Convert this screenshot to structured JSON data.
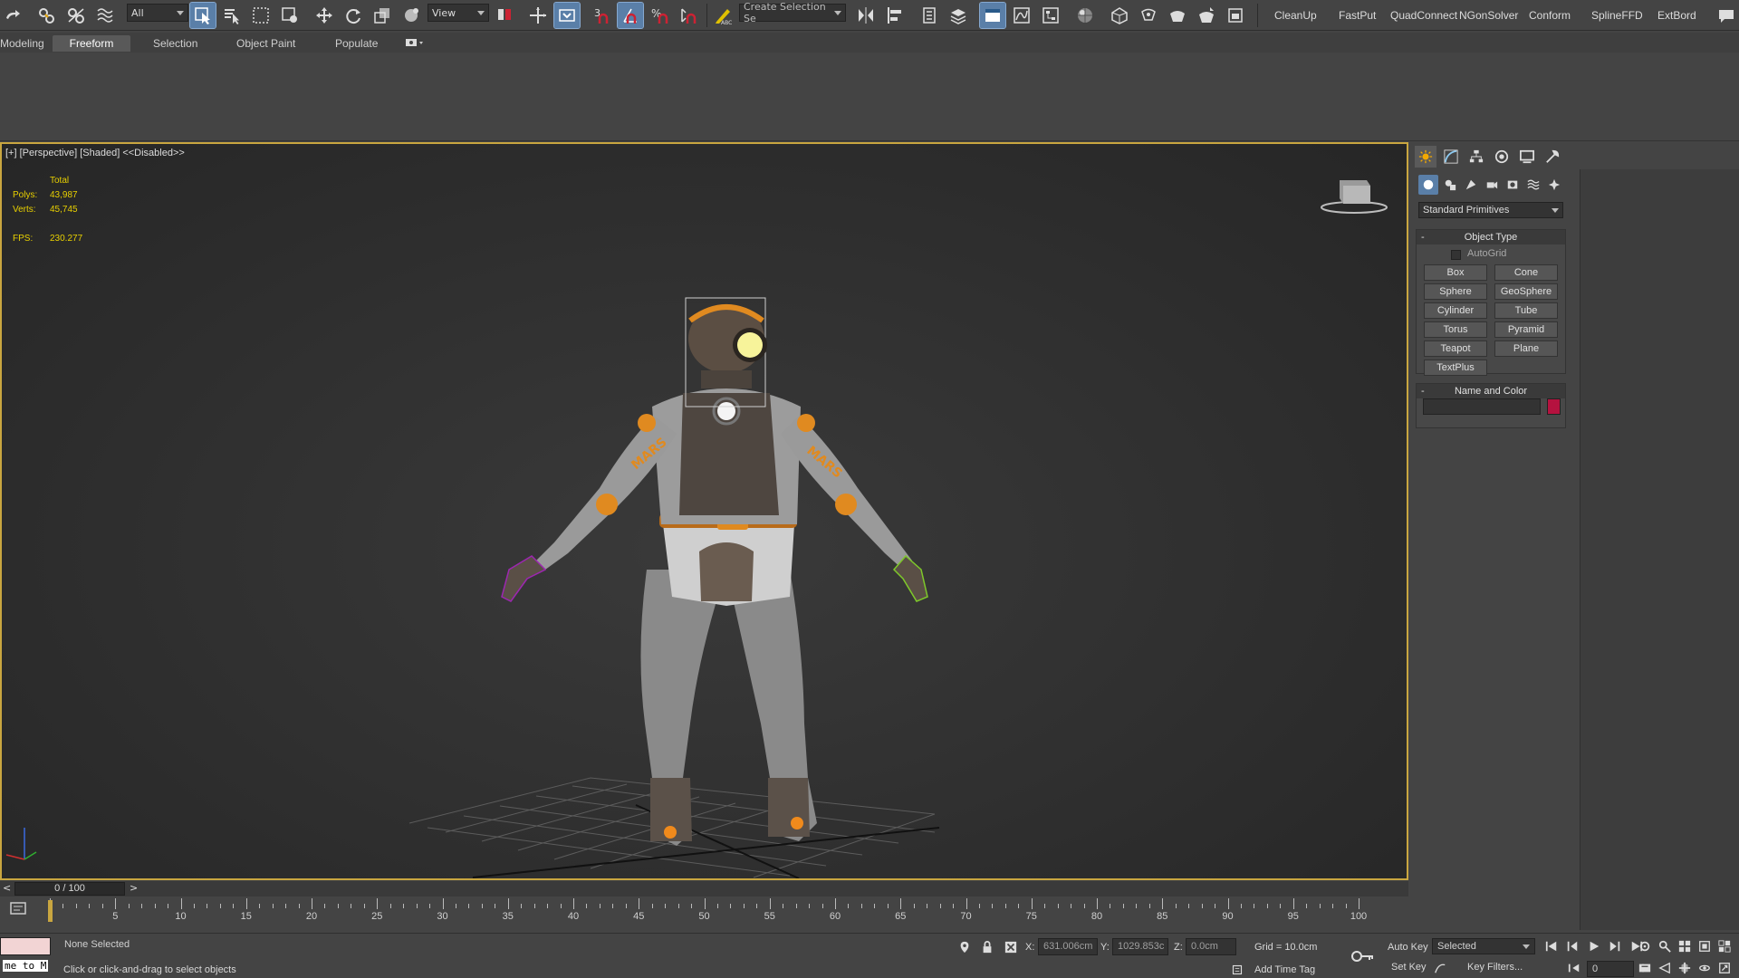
{
  "toolbar": {
    "selection_filter": "All",
    "ref_coord": "View",
    "named_selection_placeholder": "Create Selection Se",
    "snap_label": "3",
    "plugins": [
      "CleanUp",
      "FastPut",
      "QuadConnect",
      "NGonSolver",
      "Conform",
      "SplineFFD",
      "ExtBord"
    ]
  },
  "ribbon": {
    "tabs": [
      "Modeling",
      "Freeform",
      "Selection",
      "Object Paint",
      "Populate"
    ],
    "active_tab": "Freeform"
  },
  "viewport": {
    "label": "[+] [Perspective] [Shaded]  <<Disabled>>",
    "stats": {
      "total_label": "Total",
      "polys_label": "Polys:",
      "polys_value": "43,987",
      "verts_label": "Verts:",
      "verts_value": "45,745",
      "fps_label": "FPS:",
      "fps_value": "230.277"
    },
    "suit_text": "MARS"
  },
  "command_panel": {
    "dropdown": "Standard Primitives",
    "object_type_title": "Object Type",
    "autogrid_label": "AutoGrid",
    "primitives": [
      "Box",
      "Cone",
      "Sphere",
      "GeoSphere",
      "Cylinder",
      "Tube",
      "Torus",
      "Pyramid",
      "Teapot",
      "Plane",
      "TextPlus"
    ],
    "name_color_title": "Name and Color",
    "object_color": "#b5123f"
  },
  "timeline": {
    "frame_display": "0 / 100",
    "prev": "<",
    "next": ">",
    "tick_labels": [
      "5",
      "10",
      "15",
      "20",
      "25",
      "30",
      "35",
      "40",
      "45",
      "50",
      "55",
      "60",
      "65",
      "70",
      "75",
      "80",
      "85",
      "90",
      "95",
      "100"
    ]
  },
  "status": {
    "maxscript": "me to M",
    "selection_status": "None Selected",
    "prompt": "Click or click-and-drag to select objects",
    "x_label": "X:",
    "x_value": "631.006cm",
    "y_label": "Y:",
    "y_value": "1029.853c",
    "z_label": "Z:",
    "z_value": "0.0cm",
    "grid": "Grid = 10.0cm",
    "add_time_tag": "Add Time Tag",
    "auto_key": "Auto Key",
    "set_key": "Set Key",
    "key_mode": "Selected",
    "key_filters": "Key Filters...",
    "current_frame": "0"
  }
}
